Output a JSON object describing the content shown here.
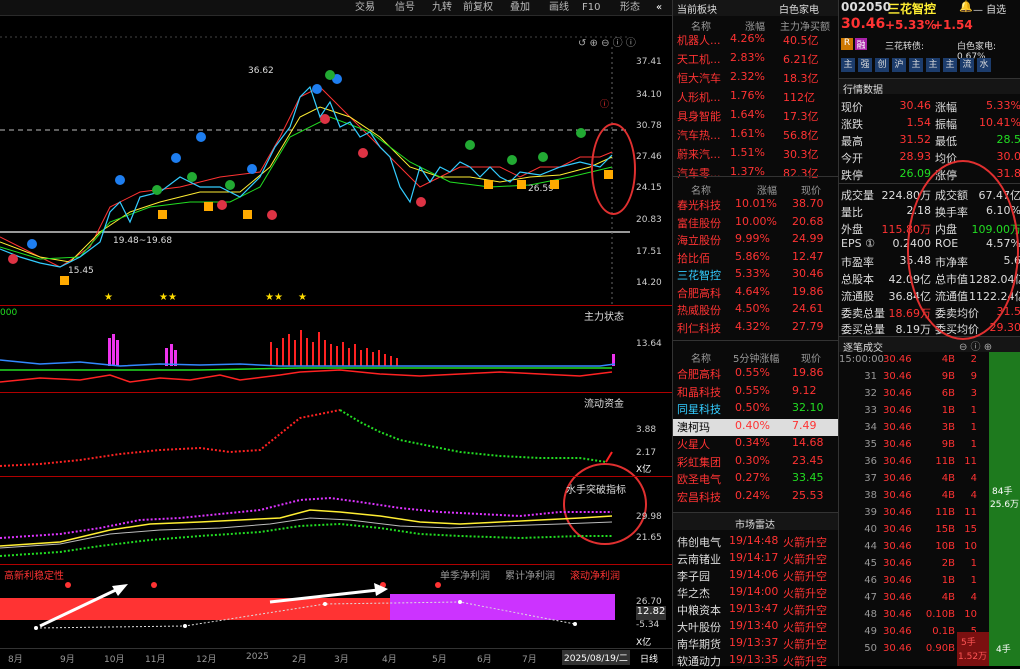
{
  "toolbar": {
    "items": [
      "交易",
      "信号",
      "九转",
      "前复权",
      "叠加",
      "画线",
      "F10",
      "形态"
    ]
  },
  "chart": {
    "price_axis": [
      "37.41",
      "34.10",
      "30.78",
      "27.46",
      "24.15",
      "20.83",
      "17.51",
      "14.20"
    ],
    "annot_high": "36.62",
    "annot_low1": "19.48~19.68",
    "annot_low2": "15.45",
    "annot_mark": "26.59",
    "panel2_title": "主力状态",
    "panel2_axis": [
      "13.64"
    ],
    "panel3_title": "流动资金",
    "panel3_axis": [
      "3.88",
      "2.17"
    ],
    "panel3_unit": "X亿",
    "panel4_title": "水手突破指标",
    "panel4_axis": [
      "29.98",
      "21.65"
    ],
    "panel5_left": "高新利稳定性",
    "panel5_tabs": [
      "单季净利润",
      "累计净利润",
      "滚动净利润"
    ],
    "panel5_axis": [
      "26.70",
      "-5.34"
    ],
    "panel5_value": "12.82",
    "panel5_unit": "X亿",
    "left_fragment": "000",
    "xaxis": [
      "8月",
      "9月",
      "10月",
      "11月",
      "12月",
      "2025",
      "2月",
      "3月",
      "4月",
      "5月",
      "6月",
      "7月"
    ],
    "date_box": "2025/08/19/二",
    "date_right": "日线"
  },
  "sector": {
    "title": "当前板块",
    "title_right": "白色家电",
    "headers": [
      "名称",
      "涨幅",
      "主力净买额"
    ],
    "rows": [
      [
        "机器人...",
        "4.26%",
        "40.5亿"
      ],
      [
        "天工机...",
        "2.83%",
        "6.21亿"
      ],
      [
        "恒大汽车",
        "2.32%",
        "18.3亿"
      ],
      [
        "人形机...",
        "1.76%",
        "112亿"
      ],
      [
        "具身智能",
        "1.64%",
        "17.3亿"
      ],
      [
        "汽车热...",
        "1.61%",
        "56.8亿"
      ],
      [
        "蔚来汽...",
        "1.51%",
        "30.3亿"
      ],
      [
        "汽车零...",
        "1.37%",
        "82.3亿"
      ]
    ]
  },
  "stocks": {
    "headers": [
      "名称",
      "涨幅",
      "现价"
    ],
    "rows": [
      [
        "春光科技",
        "10.01%",
        "38.70"
      ],
      [
        "富佳股份",
        "10.00%",
        "20.68"
      ],
      [
        "海立股份",
        "9.99%",
        "24.99"
      ],
      [
        "拾比佰",
        "5.86%",
        "12.47"
      ],
      [
        "三花智控",
        "5.33%",
        "30.46"
      ],
      [
        "合肥高科",
        "4.64%",
        "19.86"
      ],
      [
        "热威股份",
        "4.50%",
        "24.61"
      ],
      [
        "利仁科技",
        "4.32%",
        "27.79"
      ]
    ]
  },
  "speed": {
    "headers": [
      "名称",
      "5分钟涨幅",
      "现价"
    ],
    "rows": [
      [
        "合肥高科",
        "0.55%",
        "19.86"
      ],
      [
        "和晶科技",
        "0.55%",
        "9.12"
      ],
      [
        "同星科技",
        "0.50%",
        "32.10"
      ],
      [
        "澳柯玛",
        "0.40%",
        "7.49"
      ],
      [
        "火星人",
        "0.34%",
        "14.68"
      ],
      [
        "彩虹集团",
        "0.30%",
        "23.45"
      ],
      [
        "欧圣电气",
        "0.27%",
        "33.45"
      ],
      [
        "宏昌科技",
        "0.24%",
        "25.53"
      ]
    ]
  },
  "radar": {
    "title": "市场雷达",
    "rows": [
      [
        "伟创电气",
        "19/14:48",
        "火箭升空"
      ],
      [
        "云南锗业",
        "19/14:17",
        "火箭升空"
      ],
      [
        "李子园",
        "19/14:06",
        "火箭升空"
      ],
      [
        "华之杰",
        "19/14:00",
        "火箭升空"
      ],
      [
        "中粮资本",
        "19/13:47",
        "火箭升空"
      ],
      [
        "大叶股份",
        "19/13:40",
        "火箭升空"
      ],
      [
        "南华期货",
        "19/13:37",
        "火箭升空"
      ],
      [
        "软通动力",
        "19/13:35",
        "火箭升空"
      ]
    ]
  },
  "quote": {
    "code": "002050",
    "name": "三花智控",
    "self_select": "— 自选",
    "price": "30.46",
    "pct": "+5.33%",
    "chg": "+1.54",
    "tags": [
      "R",
      "融"
    ],
    "board_label": "三花转债:",
    "board_right": "白色家电: 0.67%",
    "chips": [
      "主",
      "强",
      "创",
      "沪",
      "主",
      "主",
      "主",
      "流",
      "水"
    ],
    "section": "行情数据",
    "left": [
      [
        "现价",
        "30.46"
      ],
      [
        "涨跌",
        "1.54"
      ],
      [
        "最高",
        "31.52"
      ],
      [
        "今开",
        "28.93"
      ],
      [
        "跌停",
        "26.09"
      ]
    ],
    "right": [
      [
        "涨幅",
        "5.33%"
      ],
      [
        "振幅",
        "10.41%"
      ],
      [
        "最低",
        "28.5"
      ],
      [
        "均价",
        "30.0"
      ],
      [
        "涨停",
        "31.8"
      ]
    ],
    "stats": [
      [
        "成交量",
        "224.80万",
        "成交额",
        "67.47亿"
      ],
      [
        "量比",
        "2.18",
        "换手率",
        "6.10%"
      ],
      [
        "外盘",
        "115.80万",
        "内盘",
        "109.00万"
      ],
      [
        "EPS ①",
        "0.2400",
        "ROE",
        "4.57%"
      ],
      [
        "市盈率",
        "35.48",
        "市净率",
        "5.6"
      ],
      [
        "总股本",
        "42.09亿",
        "总市值",
        "1282.04亿"
      ],
      [
        "流通股",
        "36.84亿",
        "流通值",
        "1122.24亿"
      ],
      [
        "委卖总量",
        "18.69万",
        "委卖均价",
        "31.5"
      ],
      [
        "委买总量",
        "8.19万",
        "委买均价",
        "29.30"
      ]
    ],
    "ticks_title": "逐笔成交",
    "ticks": [
      [
        "15:00:00",
        "30.46",
        "4B",
        "2"
      ],
      [
        "31",
        "30.46",
        "9B",
        "9"
      ],
      [
        "32",
        "30.46",
        "6B",
        "3"
      ],
      [
        "33",
        "30.46",
        "1B",
        "1"
      ],
      [
        "34",
        "30.46",
        "3B",
        "1"
      ],
      [
        "35",
        "30.46",
        "9B",
        "1"
      ],
      [
        "36",
        "30.46",
        "11B",
        "11"
      ],
      [
        "37",
        "30.46",
        "4B",
        "4"
      ],
      [
        "38",
        "30.46",
        "4B",
        "4"
      ],
      [
        "39",
        "30.46",
        "11B",
        "11"
      ],
      [
        "40",
        "30.46",
        "15B",
        "15"
      ],
      [
        "44",
        "30.46",
        "10B",
        "10"
      ],
      [
        "45",
        "30.46",
        "2B",
        "1"
      ],
      [
        "46",
        "30.46",
        "1B",
        "1"
      ],
      [
        "47",
        "30.46",
        "4B",
        "4"
      ],
      [
        "48",
        "30.46",
        "0.10B",
        "10"
      ],
      [
        "49",
        "30.46",
        "0.1B",
        "5"
      ],
      [
        "50",
        "30.46",
        "0.90B",
        "9"
      ]
    ],
    "bar_label": "84手",
    "bar_sub": "25.6万",
    "bar2_label": "5手",
    "bar2_sub": "1.52万",
    "bar3_label": "4手"
  }
}
